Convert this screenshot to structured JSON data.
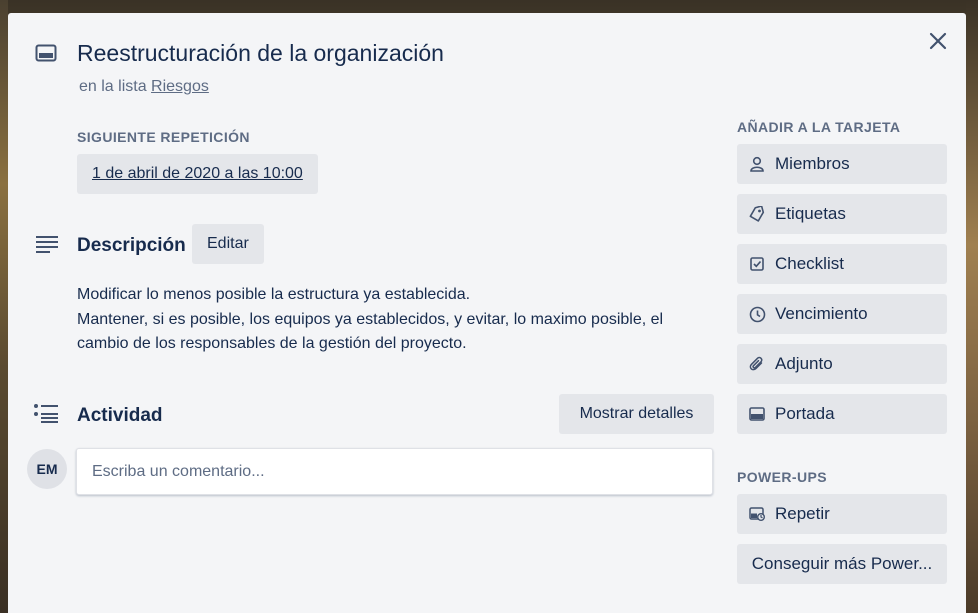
{
  "card": {
    "title": "Reestructuración de la organización",
    "list_prefix": "en la lista ",
    "list_name": "Riesgos"
  },
  "repeat": {
    "label": "SIGUIENTE REPETICIÓN",
    "date": "1 de abril de 2020 a las 10:00"
  },
  "description": {
    "title": "Descripción",
    "edit_label": "Editar",
    "lines": [
      "Modificar lo menos posible la estructura ya establecida.",
      "Mantener, si es posible, los equipos ya establecidos, y evitar, lo maximo posible, el",
      "cambio de los responsables de la gestión del proyecto."
    ]
  },
  "activity": {
    "title": "Actividad",
    "details_label": "Mostrar detalles",
    "avatar_initials": "EM",
    "comment_placeholder": "Escriba un comentario..."
  },
  "sidebar": {
    "add_label": "AÑADIR A LA TARJETA",
    "add_items": [
      {
        "label": "Miembros",
        "icon": "person-icon"
      },
      {
        "label": "Etiquetas",
        "icon": "tag-icon"
      },
      {
        "label": "Checklist",
        "icon": "checkbox-icon"
      },
      {
        "label": "Vencimiento",
        "icon": "clock-icon"
      },
      {
        "label": "Adjunto",
        "icon": "paperclip-icon"
      },
      {
        "label": "Portada",
        "icon": "cover-icon"
      }
    ],
    "powerups_label": "POWER-UPS",
    "repeat_label": "Repetir",
    "more_label": "Conseguir más Power..."
  },
  "colors": {
    "modal_bg": "#f4f5f7",
    "button_bg": "#e4e6ea",
    "text": "#172b4d",
    "muted": "#5e6c84"
  }
}
